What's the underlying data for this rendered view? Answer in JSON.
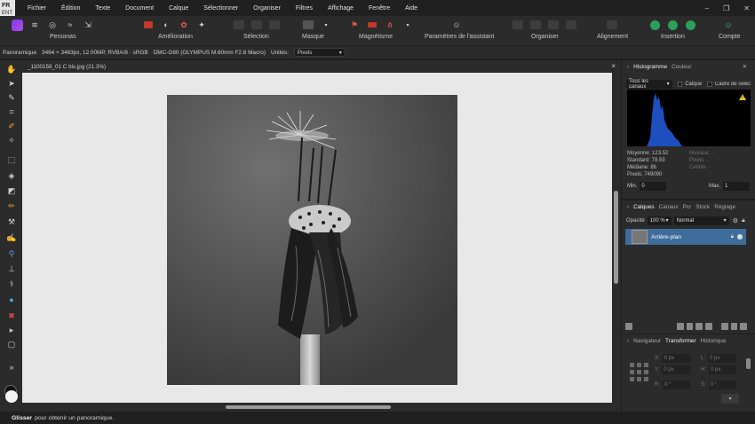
{
  "language": {
    "code": "FR",
    "sub": "ENT"
  },
  "menu": [
    "Fichier",
    "Édition",
    "Texte",
    "Document",
    "Calque",
    "Sélectionner",
    "Organiser",
    "Filtres",
    "Affichage",
    "Fenêtre",
    "Aide"
  ],
  "window_controls": {
    "minimize": "–",
    "restore": "❐",
    "close": "✕"
  },
  "toolbar": {
    "personas": "Personas",
    "amelioration": "Amélioration",
    "selection": "Sélection",
    "masque": "Masque",
    "magnetisme": "Magnétisme",
    "parametres": "Paramètres de l'assistant",
    "organiser": "Organiser",
    "alignement": "Alignement",
    "insertion": "Insertion",
    "compte": "Compte"
  },
  "context": {
    "tool": "Panoramique",
    "info": "3464 × 3463px, 12.00MP, RVBA/8 · sRGB",
    "camera": "DMC-G80 (OLYMPUS M.60mm F2.8 Macro)",
    "units_label": "Unités:",
    "units_value": "Pixels"
  },
  "document": {
    "tab_title": "_1100158_01 C bis.jpg (21.3%)",
    "close": "×"
  },
  "status": {
    "bold": "Glisser",
    "text": "pour obtenir un panoramique."
  },
  "histogram_panel": {
    "tabs": [
      "Histogramme",
      "Couleur"
    ],
    "channels": "Tous les canaux",
    "calque_label": "Calque",
    "cadre_label": "Cadre de sélection",
    "stats": [
      "Moyenne: 123.52",
      "Standard: 78.59",
      "Médiane: 86",
      "Pixels: 749090"
    ],
    "stats_dim": [
      "Niveaux: -",
      "Pixels: -",
      "Centile: -"
    ],
    "min_label": "Min.",
    "min_value": "0",
    "max_label": "Max.",
    "max_value": "1",
    "colors": {
      "bars": "#1f4fbf",
      "warning": "#f5c518"
    }
  },
  "layers_panel": {
    "tabs": [
      "Calques",
      "Canaux",
      "Pcr",
      "Stock",
      "Réglage"
    ],
    "opacity_label": "Opacité",
    "opacity_value": "100 %",
    "blend_mode": "Normal",
    "layer_name": "Arrière-plan"
  },
  "transform_panel": {
    "tabs": [
      "Navigateur",
      "Transformer",
      "Historique"
    ],
    "fields": [
      {
        "label": "X:",
        "value": "0 px"
      },
      {
        "label": "L:",
        "value": "0 px"
      },
      {
        "label": "Y:",
        "value": "0 px"
      },
      {
        "label": "H:",
        "value": "0 px"
      },
      {
        "label": "R:",
        "value": "0 °"
      },
      {
        "label": "S:",
        "value": "0 °"
      }
    ]
  },
  "accent_color": "#3e6d9c"
}
